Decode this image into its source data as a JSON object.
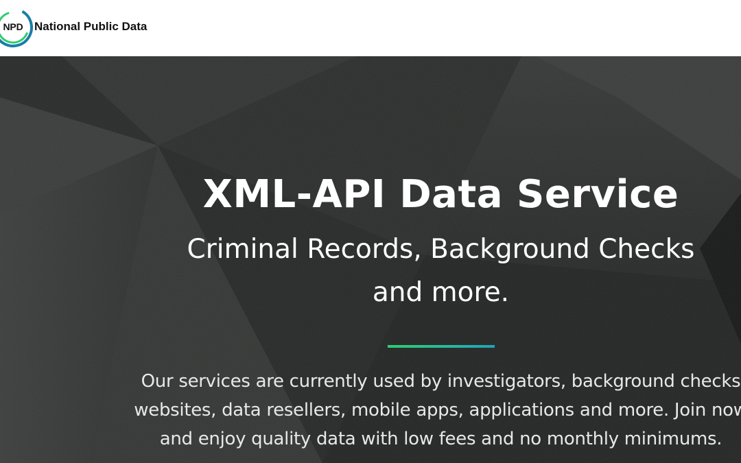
{
  "header": {
    "logo": {
      "text": "NPD",
      "icon": "npd-ring-logo-icon",
      "ring_colors": [
        "#1b7ea6",
        "#2ecc71"
      ]
    },
    "brand_name": "National Public Data"
  },
  "hero": {
    "title": "XML-API Data Service",
    "subtitle_line_1": "Criminal Records, Background Checks",
    "subtitle_line_2": "and more.",
    "divider_colors": [
      "#2ecc71",
      "#1fa2b8"
    ],
    "description_line_1": "Our services are currently used by investigators, background checks",
    "description_line_2": "websites, data resellers, mobile apps, applications and more. Join now",
    "description_line_3": "and enjoy quality data with low fees and no monthly minimums.",
    "background": "dark-concrete-geometric-texture"
  }
}
